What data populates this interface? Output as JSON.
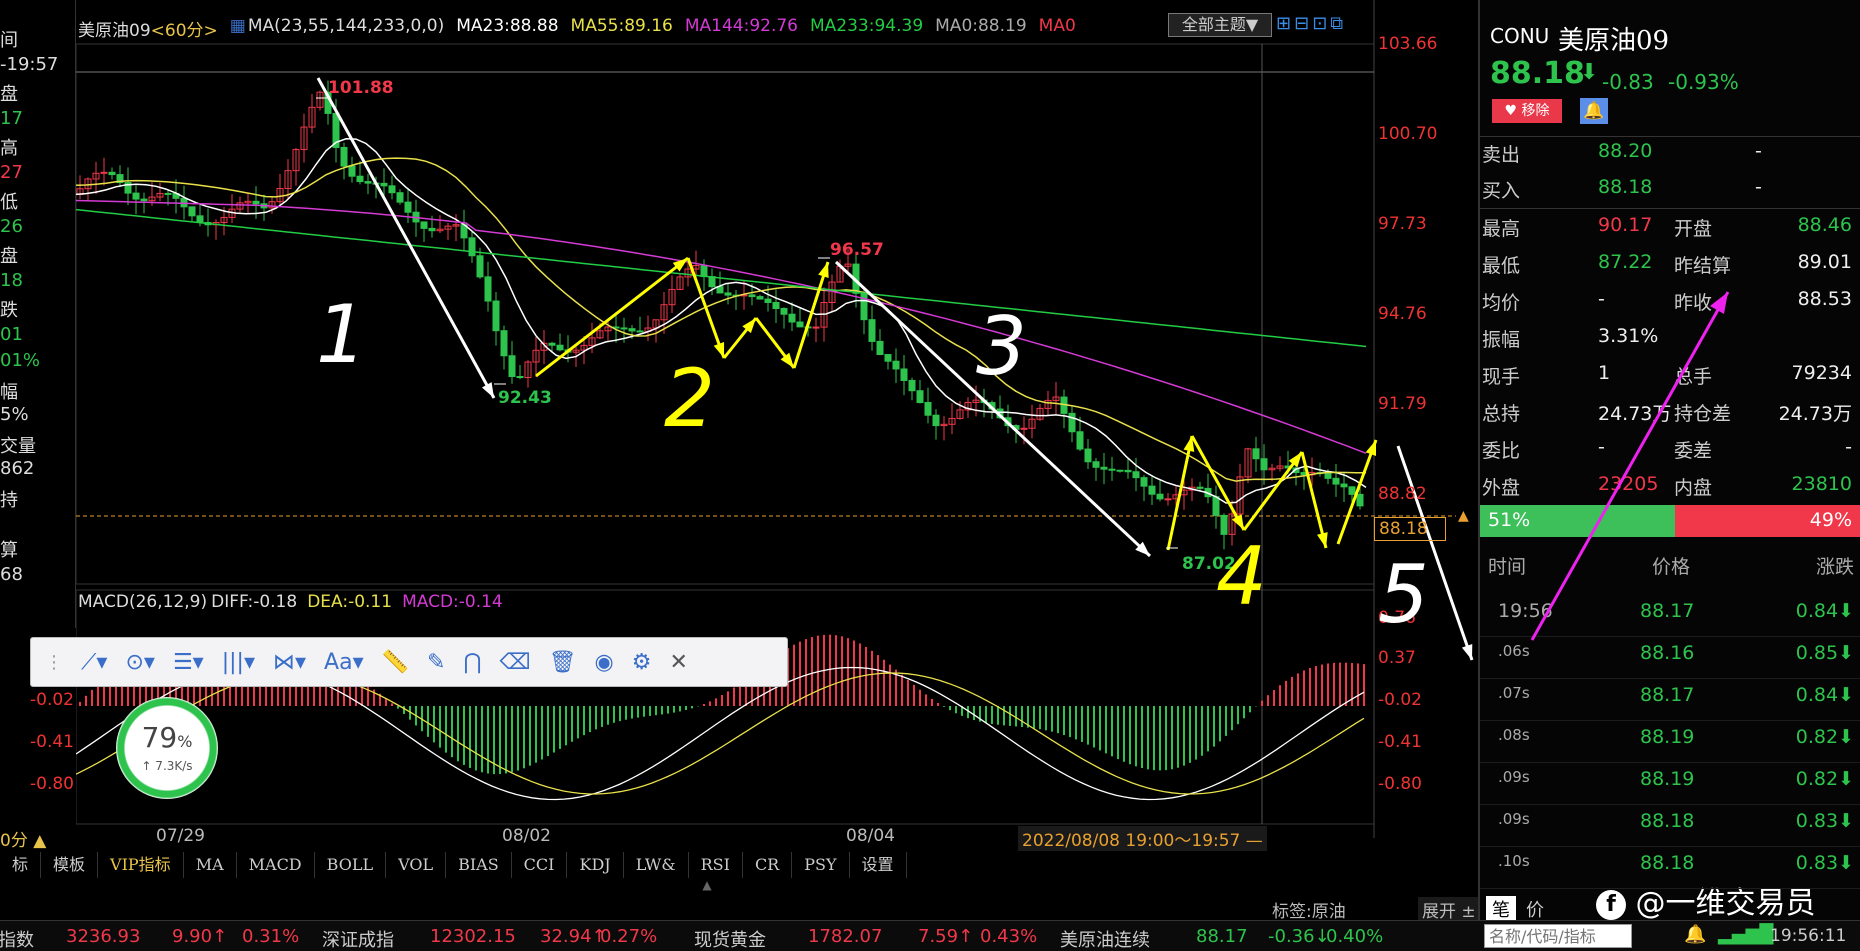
{
  "left_panel": {
    "labels": [
      "间",
      "-19:57",
      "盘",
      "17",
      "高",
      "27",
      "低",
      "26",
      "盘",
      "18",
      "跌",
      "01",
      "01%",
      "幅",
      "5%",
      "交量",
      "862",
      "持",
      "算",
      "68"
    ]
  },
  "legend": {
    "symbol": "美原油09",
    "period": "<60分>",
    "ma_def": "MA(23,55,144,233,0,0)",
    "ma23": "MA23:88.88",
    "ma55": "MA55:89.16",
    "ma144": "MA144:92.76",
    "ma233": "MA233:94.39",
    "ma0a": "MA0:88.19",
    "ma0b": "MA0",
    "theme_button": "全部主题▼"
  },
  "price_axis": [
    "103.66",
    "100.70",
    "97.73",
    "94.76",
    "91.79",
    "88.82",
    "0.76",
    "0.37",
    "-0.02",
    "-0.41",
    "-0.80"
  ],
  "current_price_tag": "88.18",
  "macd_axis_left": [
    "-0.02",
    "-0.41",
    "-0.80"
  ],
  "macd_legend": {
    "def": "MACD(26,12,9)",
    "diff": "DIFF:-0.18",
    "dea": "DEA:-0.11",
    "macd": "MACD:-0.14"
  },
  "chart_annotations": {
    "high": "101.88",
    "low1": "92.43",
    "peak2": "96.57",
    "low2": "87.02",
    "hand_1": "1",
    "hand_2": "2",
    "hand_3": "3",
    "hand_4": "4",
    "hand_5": "5"
  },
  "x_axis": [
    "07/29",
    "08/02",
    "08/04"
  ],
  "crosshair_time": "2022/08/08 19:00～19:57 —",
  "period_marker": "0分 ▲",
  "network": {
    "percent": "79",
    "unit": "%",
    "speed": "↑ 7.3K/s"
  },
  "colors": {
    "ma23": "#ffffff",
    "ma55": "#e8e04a",
    "ma144": "#d43ad4",
    "ma233": "#22cc44",
    "up": "#f0384a",
    "down": "#2ec34d",
    "annot_yellow": "#ffff00",
    "annot_pink": "#ee22ee"
  },
  "bottom_tabs": [
    "标",
    "模板",
    "VIP指标",
    "MA",
    "MACD",
    "BOLL",
    "VOL",
    "BIAS",
    "CCI",
    "KDJ",
    "LW&",
    "RSI",
    "CR",
    "PSY",
    "设置"
  ],
  "tag_label": "标签:原油",
  "expand_label": "展开 ±",
  "quote": {
    "code": "CONU",
    "name": "美原油09",
    "price": "88.18",
    "arrow": "⬇",
    "change": "-0.83",
    "pct": "-0.93%",
    "remove_btn": "移除",
    "sell_label": "卖出",
    "sell_price": "88.20",
    "sell_vol": "-",
    "buy_label": "买入",
    "buy_price": "88.18",
    "buy_vol": "-",
    "rows": [
      {
        "l1": "最高",
        "v1": "90.17",
        "c1": "red",
        "l2": "开盘",
        "v2": "88.46",
        "c2": "green"
      },
      {
        "l1": "最低",
        "v1": "87.22",
        "c1": "green",
        "l2": "昨结算",
        "v2": "89.01",
        "c2": "white"
      },
      {
        "l1": "均价",
        "v1": "-",
        "c1": "white",
        "l2": "昨收",
        "v2": "88.53",
        "c2": "white"
      },
      {
        "l1": "振幅",
        "v1": "3.31%",
        "c1": "white",
        "l2": "",
        "v2": "",
        "c2": "white"
      },
      {
        "l1": "现手",
        "v1": "1",
        "c1": "white",
        "l2": "总手",
        "v2": "79234",
        "c2": "white"
      },
      {
        "l1": "总持",
        "v1": "24.73万",
        "c1": "white",
        "l2": "持仓差",
        "v2": "24.73万",
        "c2": "white"
      },
      {
        "l1": "委比",
        "v1": "-",
        "c1": "white",
        "l2": "委差",
        "v2": "-",
        "c2": "white"
      },
      {
        "l1": "外盘",
        "v1": "23205",
        "c1": "red",
        "l2": "内盘",
        "v2": "23810",
        "c2": "green"
      }
    ],
    "bar_left": "51%",
    "bar_right": "49%",
    "bar_left_frac": 0.51,
    "ticks_header": {
      "time": "时间",
      "price": "价格",
      "chg": "涨跌"
    },
    "ticks": [
      {
        "t": "19:56",
        "p": "88.17",
        "c": "0.84⬇"
      },
      {
        "t": ".06s",
        "p": "88.16",
        "c": "0.85⬇"
      },
      {
        "t": ".07s",
        "p": "88.17",
        "c": "0.84⬇"
      },
      {
        "t": ".08s",
        "p": "88.19",
        "c": "0.82⬇"
      },
      {
        "t": ".09s",
        "p": "88.19",
        "c": "0.82⬇"
      },
      {
        "t": ".09s",
        "p": "88.18",
        "c": "0.83⬇"
      },
      {
        "t": ".10s",
        "p": "88.18",
        "c": "0.83⬇"
      }
    ],
    "tab_bi": "笔",
    "tab_jia": "价",
    "watermark": "@一维交易员",
    "search_placeholder": "名称/代码/指标",
    "clock": "19:56:11"
  },
  "status_bar": [
    {
      "t": "指数",
      "c": "#ccc"
    },
    {
      "t": "3236.93",
      "c": "#f0384a"
    },
    {
      "t": "9.90↑",
      "c": "#f0384a"
    },
    {
      "t": "0.31%",
      "c": "#f0384a"
    },
    {
      "t": "深证成指",
      "c": "#ccc"
    },
    {
      "t": "12302.15",
      "c": "#f0384a"
    },
    {
      "t": "32.94↑",
      "c": "#f0384a"
    },
    {
      "t": "0.27%",
      "c": "#f0384a"
    },
    {
      "t": "现货黄金",
      "c": "#ccc"
    },
    {
      "t": "1782.07",
      "c": "#f0384a"
    },
    {
      "t": "7.59↑",
      "c": "#f0384a"
    },
    {
      "t": "0.43%",
      "c": "#f0384a"
    },
    {
      "t": "美原油连续",
      "c": "#ccc"
    },
    {
      "t": "88.17",
      "c": "#2ec34d"
    },
    {
      "t": "-0.36↓",
      "c": "#2ec34d"
    },
    {
      "t": "0.40%",
      "c": "#2ec34d"
    }
  ]
}
